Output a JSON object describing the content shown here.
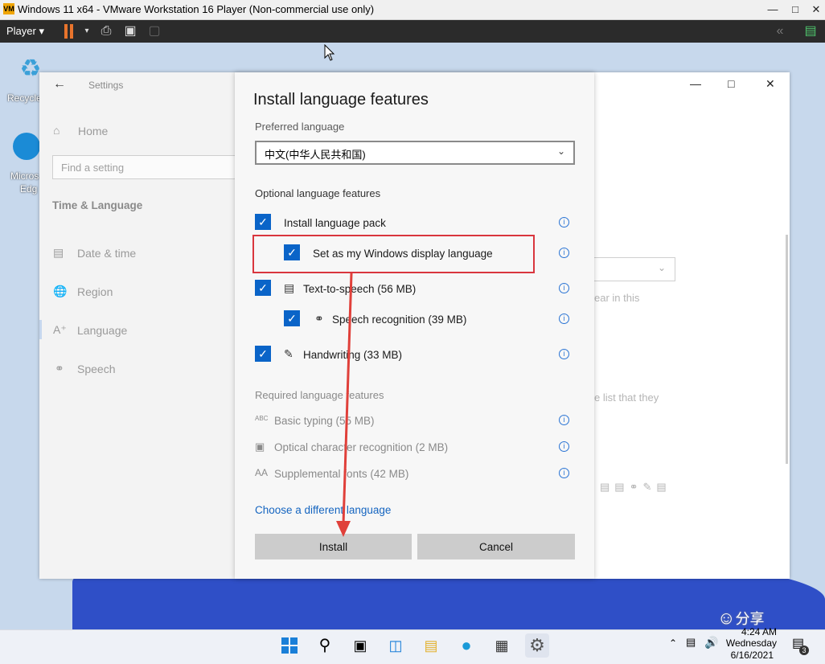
{
  "vmware": {
    "window_title": "Windows 11 x64 - VMware Workstation 16 Player (Non-commercial use only)",
    "player_menu": "Player",
    "logo_text": "VM"
  },
  "desktop": {
    "recycle_label": "Recycle",
    "edge_label_1": "Micros",
    "edge_label_2": "Edg"
  },
  "settings": {
    "app_title": "Settings",
    "home": "Home",
    "find_placeholder": "Find a setting",
    "section": "Time & Language",
    "nav": [
      {
        "label": "Date & time",
        "icon": "calendar-clock-icon"
      },
      {
        "label": "Region",
        "icon": "globe-icon"
      },
      {
        "label": "Language",
        "icon": "language-icon"
      },
      {
        "label": "Speech",
        "icon": "microphone-icon"
      }
    ],
    "bg_text_1": "ear in this",
    "bg_text_2": "e list that they"
  },
  "dialog": {
    "title": "Install language features",
    "preferred_label": "Preferred language",
    "preferred_value": "中文(中华人民共和国)",
    "optional_label": "Optional language features",
    "optional": [
      {
        "label": "Install language pack",
        "checked": true
      },
      {
        "label": "Set as my Windows display language",
        "checked": true
      },
      {
        "label": "Text-to-speech (56 MB)",
        "checked": true
      },
      {
        "label": "Speech recognition (39 MB)",
        "checked": true
      },
      {
        "label": "Handwriting (33 MB)",
        "checked": true
      }
    ],
    "required_label": "Required language features",
    "required": [
      {
        "label": "Basic typing (55 MB)",
        "icon_text": "ABC"
      },
      {
        "label": "Optical character recognition (2 MB)",
        "icon_text": ""
      },
      {
        "label": "Supplemental fonts (42 MB)",
        "icon_text": "AA"
      }
    ],
    "choose_link": "Choose a different language",
    "install_button": "Install",
    "cancel_button": "Cancel"
  },
  "taskbar": {
    "time": "4:24 AM",
    "day": "Wednesday",
    "date": "6/16/2021",
    "notification_count": "3",
    "watermark": "分享"
  },
  "colors": {
    "accent": "#0a64c8",
    "highlight_box": "#d9363e",
    "arrow": "#e0403a"
  }
}
